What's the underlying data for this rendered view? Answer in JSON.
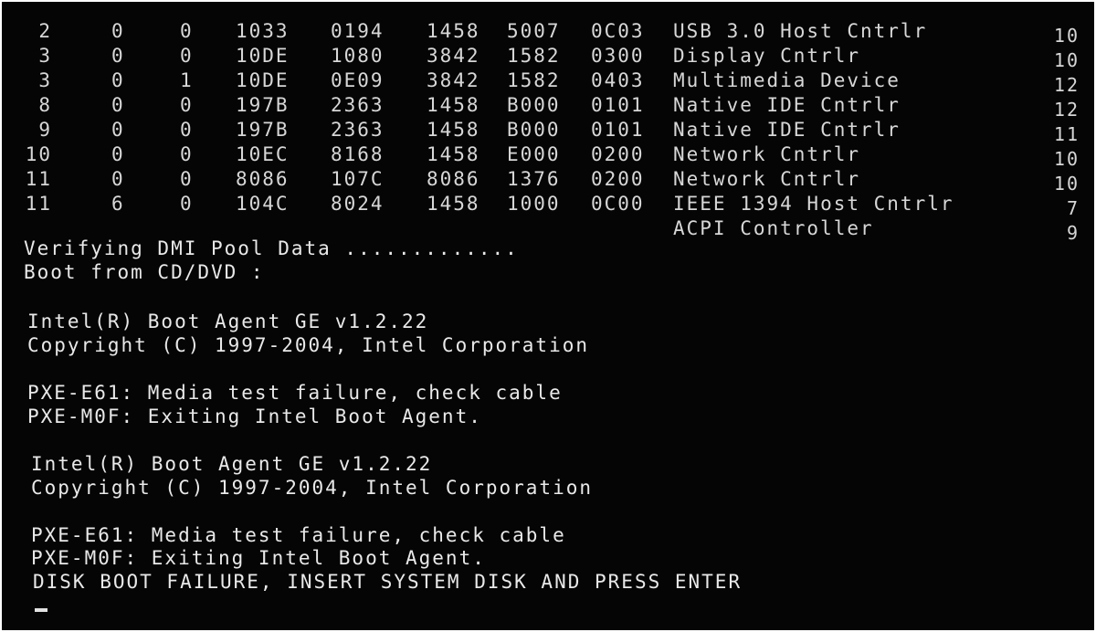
{
  "pci_devices": [
    {
      "bus": "2",
      "device": "0",
      "func": "0",
      "vendor": "1033",
      "device_id": "0194",
      "svid": "1458",
      "ssid": "5007",
      "class": "0C03",
      "name": "USB 3.0 Host Cntrlr",
      "irq": "10"
    },
    {
      "bus": "3",
      "device": "0",
      "func": "0",
      "vendor": "10DE",
      "device_id": "1080",
      "svid": "3842",
      "ssid": "1582",
      "class": "0300",
      "name": "Display Cntrlr",
      "irq": "10"
    },
    {
      "bus": "3",
      "device": "0",
      "func": "1",
      "vendor": "10DE",
      "device_id": "0E09",
      "svid": "3842",
      "ssid": "1582",
      "class": "0403",
      "name": "Multimedia Device",
      "irq": "12"
    },
    {
      "bus": "8",
      "device": "0",
      "func": "0",
      "vendor": "197B",
      "device_id": "2363",
      "svid": "1458",
      "ssid": "B000",
      "class": "0101",
      "name": "Native IDE Cntrlr",
      "irq": "12"
    },
    {
      "bus": "9",
      "device": "0",
      "func": "0",
      "vendor": "197B",
      "device_id": "2363",
      "svid": "1458",
      "ssid": "B000",
      "class": "0101",
      "name": "Native IDE Cntrlr",
      "irq": "11"
    },
    {
      "bus": "10",
      "device": "0",
      "func": "0",
      "vendor": "10EC",
      "device_id": "8168",
      "svid": "1458",
      "ssid": "E000",
      "class": "0200",
      "name": "Network Cntrlr",
      "irq": "10"
    },
    {
      "bus": "11",
      "device": "0",
      "func": "0",
      "vendor": "8086",
      "device_id": "107C",
      "svid": "8086",
      "ssid": "1376",
      "class": "0200",
      "name": "Network Cntrlr",
      "irq": "10"
    },
    {
      "bus": "11",
      "device": "6",
      "func": "0",
      "vendor": "104C",
      "device_id": "8024",
      "svid": "1458",
      "ssid": "1000",
      "class": "0C00",
      "name": "IEEE 1394 Host Cntrlr",
      "irq": "7"
    },
    {
      "bus": "",
      "device": "",
      "func": "",
      "vendor": "",
      "device_id": "",
      "svid": "",
      "ssid": "",
      "class": "",
      "name": "ACPI Controller",
      "irq": "9"
    }
  ],
  "boot": {
    "dmi_verify": "Verifying DMI Pool Data .............",
    "boot_from": "Boot from CD/DVD :",
    "agent_1": {
      "title": "Intel(R) Boot Agent GE v1.2.22",
      "copyright": "Copyright (C) 1997-2004, Intel Corporation",
      "error": "PXE-E61: Media test failure, check cable",
      "exit": "PXE-M0F: Exiting Intel Boot Agent."
    },
    "agent_2": {
      "title": "Intel(R) Boot Agent GE v1.2.22",
      "copyright": "Copyright (C) 1997-2004, Intel Corporation",
      "error": "PXE-E61: Media test failure, check cable",
      "exit": "PXE-M0F: Exiting Intel Boot Agent."
    },
    "disk_failure": "DISK BOOT FAILURE, INSERT SYSTEM DISK AND PRESS ENTER"
  }
}
